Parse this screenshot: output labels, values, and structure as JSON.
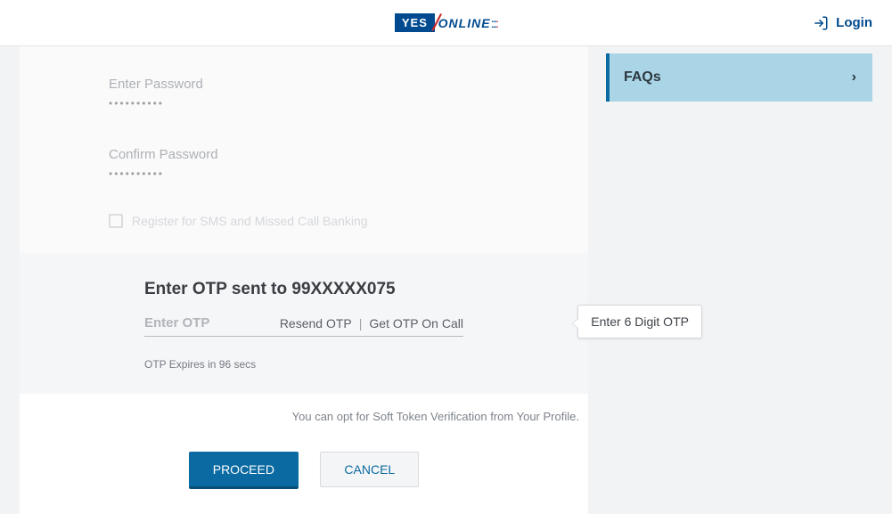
{
  "header": {
    "logo_yes": "YES",
    "logo_online": "ONLINE",
    "login_label": "Login"
  },
  "form": {
    "enter_password_label": "Enter Password",
    "enter_password_value": "••••••••••",
    "confirm_password_label": "Confirm Password",
    "confirm_password_value": "••••••••••",
    "checkbox_label": "Register for SMS and Missed Call Banking"
  },
  "otp": {
    "heading": "Enter OTP sent to 99XXXXX075",
    "input_placeholder": "Enter OTP",
    "resend_label": "Resend OTP",
    "separator": "|",
    "oncall_label": "Get OTP On Call",
    "tooltip": "Enter 6 Digit OTP",
    "expire_text": "OTP Expires in 96 secs"
  },
  "footer": {
    "opt_text": "You can opt for Soft Token Verification from Your Profile.",
    "proceed_label": "PROCEED",
    "cancel_label": "CANCEL"
  },
  "sidebar": {
    "faq_label": "FAQs"
  }
}
